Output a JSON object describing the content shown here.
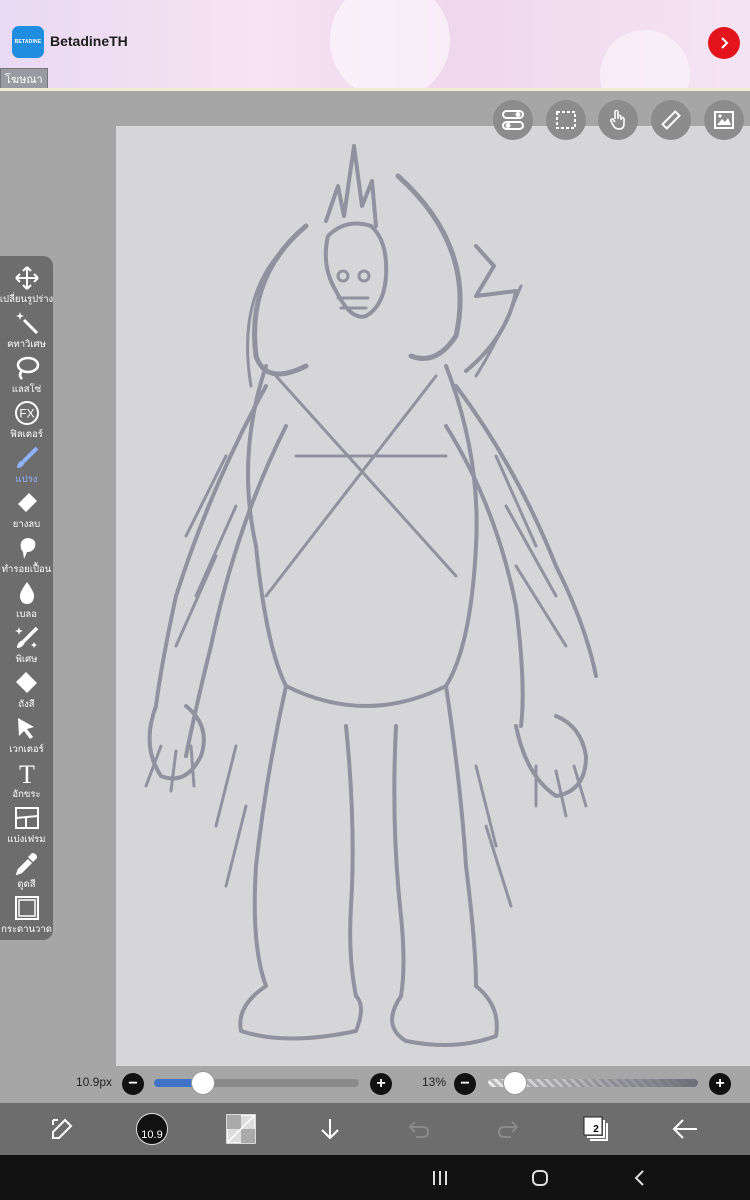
{
  "ad": {
    "logo_text": "BETADINE",
    "title": "BetadineTH",
    "tag": "โฆษณา",
    "accent": "#e3141c",
    "icon": "chevron-right-icon"
  },
  "top_tools": [
    {
      "name": "toggle-icon"
    },
    {
      "name": "selection-icon"
    },
    {
      "name": "touch-icon"
    },
    {
      "name": "ruler-icon"
    },
    {
      "name": "image-icon"
    }
  ],
  "toolbar": {
    "items": [
      {
        "label": "เปลี่ยนรูปร่าง",
        "icon": "move-icon"
      },
      {
        "label": "คทาวิเศษ",
        "icon": "magic-wand-icon"
      },
      {
        "label": "แลสโซ่",
        "icon": "lasso-icon"
      },
      {
        "label": "ฟิลเตอร์",
        "icon": "fx-icon"
      },
      {
        "label": "แปรง",
        "icon": "brush-icon",
        "active": true
      },
      {
        "label": "ยางลบ",
        "icon": "eraser-icon"
      },
      {
        "label": "ทำรอยเปื้อน",
        "icon": "smudge-icon"
      },
      {
        "label": "เบลอ",
        "icon": "blur-drop-icon"
      },
      {
        "label": "พิเศษ",
        "icon": "special-icon"
      },
      {
        "label": "ถังสี",
        "icon": "bucket-icon"
      },
      {
        "label": "เวกเตอร์",
        "icon": "vector-cursor-icon"
      },
      {
        "label": "อักขระ",
        "icon": "text-icon"
      },
      {
        "label": "แบ่งเฟรม",
        "icon": "frame-divider-icon"
      },
      {
        "label": "ดูดสี",
        "icon": "eyedropper-icon"
      },
      {
        "label": "กระดานวาด",
        "icon": "canvas-icon"
      }
    ],
    "fx_text": "FX",
    "text_glyph": "T"
  },
  "size_slider": {
    "value_text": "10.9px",
    "fraction": 0.24,
    "minus": "−",
    "plus": "+"
  },
  "opacity_slider": {
    "value_text": "13%",
    "fraction": 0.13,
    "minus": "−",
    "plus": "+"
  },
  "bottombar": {
    "brush_size": "10.9",
    "layers_count": "2"
  },
  "colors": {
    "toolbar_bg": "#6d6d6d",
    "canvas_bg": "#d6d6d8",
    "active_tool": "#8fb4ff",
    "slider_fill": "#3f73c8",
    "sketch_stroke": "#7a7b8c"
  }
}
